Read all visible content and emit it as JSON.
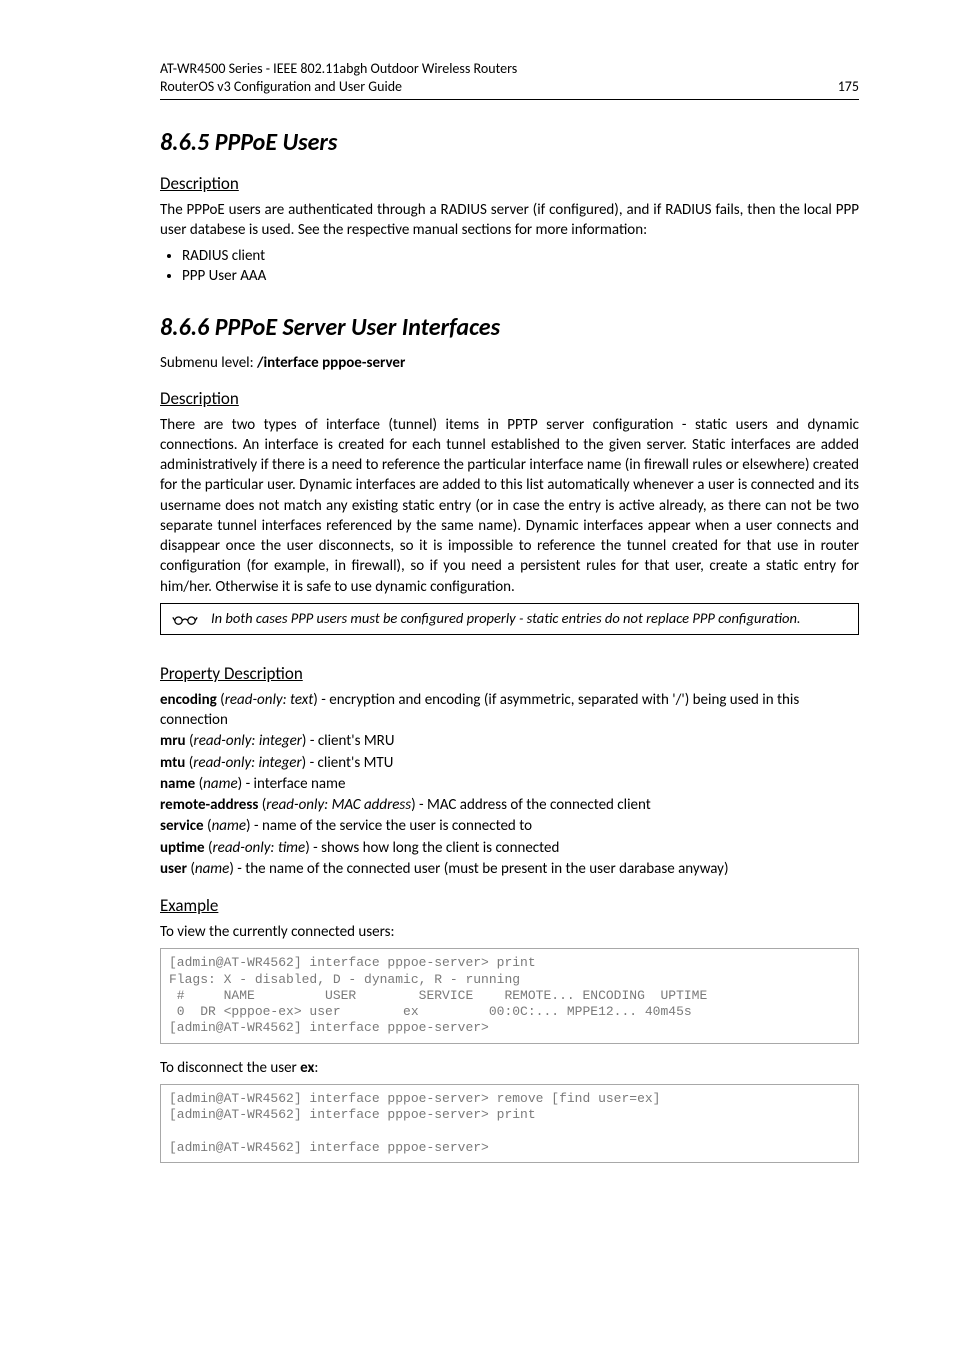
{
  "header": {
    "line1": "AT-WR4500 Series - IEEE 802.11abgh Outdoor Wireless Routers",
    "line2": "RouterOS v3 Configuration and User Guide",
    "pagenum": "175"
  },
  "s865": {
    "heading": "8.6.5  PPPoE Users",
    "desc_h": "Description",
    "desc_p": "The PPPoE users are authenticated through a RADIUS server (if configured), and if RADIUS fails, then the local PPP user databese is used. See the respective manual sections for more information:",
    "b1": "RADIUS client",
    "b2": "PPP User AAA"
  },
  "s866": {
    "heading": "8.6.6  PPPoE Server User Interfaces",
    "submenu_pre": "Submenu level: ",
    "submenu_bold": "/interface pppoe-server",
    "desc_h": "Description",
    "desc_p": "There are two types of interface (tunnel) items in PPTP server configuration - static users and dynamic connections. An interface is created for each tunnel established to the given server. Static interfaces are added administratively if there is a need to reference the particular interface name (in firewall rules or elsewhere) created for the particular user. Dynamic interfaces are added to this list automatically whenever a user is connected and its username does not match any existing static entry (or in case the entry is active already, as there can not be two separate tunnel interfaces referenced by the same name). Dynamic interfaces appear when a user connects and disappear once the user disconnects, so it is impossible to reference the tunnel created for that use in router configuration (for example, in firewall), so if you need a persistent rules for that user, create a static entry for him/her. Otherwise it is safe to use dynamic configuration.",
    "note": "In both cases PPP users must be configured properly - static entries do not replace PPP configuration."
  },
  "props": {
    "h": "Property Description",
    "encoding": {
      "n": "encoding",
      "t": "read-only: text",
      "d": " - encryption and encoding (if asymmetric, separated with '/') being used in this connection"
    },
    "mru": {
      "n": "mru",
      "t": "read-only: integer",
      "d": " - client's MRU"
    },
    "mtu": {
      "n": "mtu",
      "t": "read-only: integer",
      "d": " - client's MTU"
    },
    "name": {
      "n": "name",
      "t": "name",
      "d": " - interface name"
    },
    "remote": {
      "n": "remote-address",
      "t": "read-only: MAC address",
      "d": " - MAC address of the connected client"
    },
    "service": {
      "n": "service",
      "t": "name",
      "d": " - name of the service the user is connected to"
    },
    "uptime": {
      "n": "uptime",
      "t": "read-only: time",
      "d": " - shows how long the client is connected"
    },
    "user": {
      "n": "user",
      "t": "name",
      "d": " - the name of the connected user (must be present in the user darabase anyway)"
    }
  },
  "example": {
    "h": "Example",
    "p1": "To view the currently connected users:",
    "code1": "[admin@AT-WR4562] interface pppoe-server> print\nFlags: X - disabled, D - dynamic, R - running\n #     NAME         USER        SERVICE    REMOTE... ENCODING  UPTIME\n 0  DR <pppoe-ex> user        ex         00:0C:... MPPE12... 40m45s\n[admin@AT-WR4562] interface pppoe-server>",
    "p2_pre": "To disconnect the user ",
    "p2_bold": "ex",
    "p2_post": ":",
    "code2": "[admin@AT-WR4562] interface pppoe-server> remove [find user=ex]\n[admin@AT-WR4562] interface pppoe-server> print\n\n[admin@AT-WR4562] interface pppoe-server>"
  }
}
